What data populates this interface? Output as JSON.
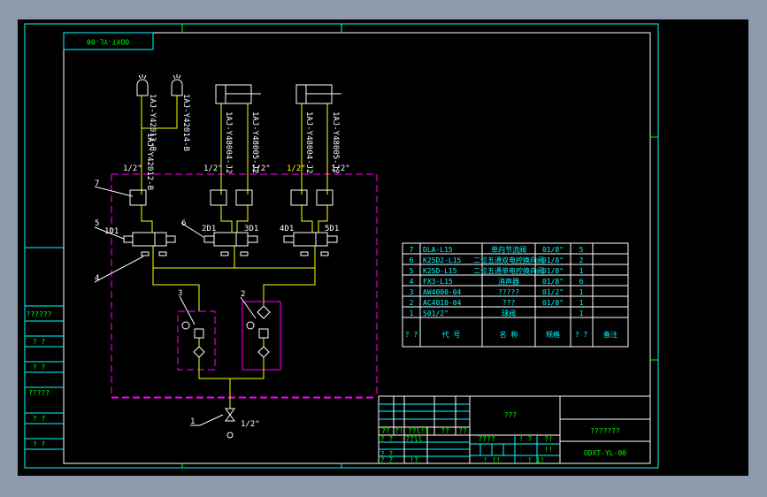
{
  "drawing": {
    "code": "ODXT-YL-00",
    "colors": {
      "background": "#000000",
      "frame": "#00ffff",
      "pipe": "#ffff00",
      "group": "#ff00ff",
      "symbol": "#ffffff",
      "titletext": "#00ff00"
    }
  },
  "pipe_labels": {
    "lamp_line": "1AJ-Y42012-B",
    "lamp_1": "1AJ-Y42013-B",
    "lamp_2": "1AJ-Y42014-B",
    "cyl1_a": "1AJ-Y48004-J2",
    "cyl1_b": "1AJ-Y48005-J2",
    "cyl2_a": "1AJ-Y48004-J2",
    "cyl2_b": "1AJ-Y48005-J2",
    "size": "1/2\""
  },
  "callouts": [
    "1",
    "2",
    "3",
    "4",
    "5",
    "6",
    "7"
  ],
  "valve_tags": {
    "v1_left": "1D1",
    "v2_left": "2D1",
    "v2_right": "3D1",
    "v3_left": "4D1",
    "v3_right": "5D1"
  },
  "bom": {
    "rows": [
      {
        "no": "7",
        "code": "DLA-L15",
        "name": "单向节流阀",
        "spec": "01/8\"",
        "qty": "5"
      },
      {
        "no": "6",
        "code": "K25D2-L15",
        "name": "二位五通双电控换向阀",
        "spec": "01/8\"",
        "qty": "2"
      },
      {
        "no": "5",
        "code": "K25D-L15",
        "name": "二位五通单电控换向阀",
        "spec": "01/8\"",
        "qty": "1"
      },
      {
        "no": "4",
        "code": "FX3-L15",
        "name": "消声器",
        "spec": "01/8\"",
        "qty": "6"
      },
      {
        "no": "3",
        "code": "AW4000-04",
        "name": "?????",
        "spec": "01/2\"",
        "qty": "1"
      },
      {
        "no": "2",
        "code": "AC4010-04",
        "name": "???",
        "spec": "01/8\"",
        "qty": "1"
      },
      {
        "no": "1",
        "code": "S01/2\"",
        "name": "球阀",
        "spec": "",
        "qty": "1"
      }
    ],
    "header": {
      "no": "?\n?",
      "code": "代 号",
      "name": "名 称",
      "spec": "规格",
      "qty": "?\n?",
      "remark": "备注"
    }
  },
  "left_strip": [
    "??????",
    "? ?",
    "? ?",
    "?????",
    "? ?",
    "? ?"
  ],
  "title_block": {
    "title": "???",
    "company": "???????",
    "drawing_no": "ODXT-YL-00",
    "small": [
      "??",
      "?!",
      "??l!l",
      "??",
      "??",
      "? ?",
      "??ll",
      "? ?",
      "? ?",
      "!?",
      "????",
      "! ?",
      "?!",
      "!!",
      "! !!",
      "! 1!"
    ]
  }
}
